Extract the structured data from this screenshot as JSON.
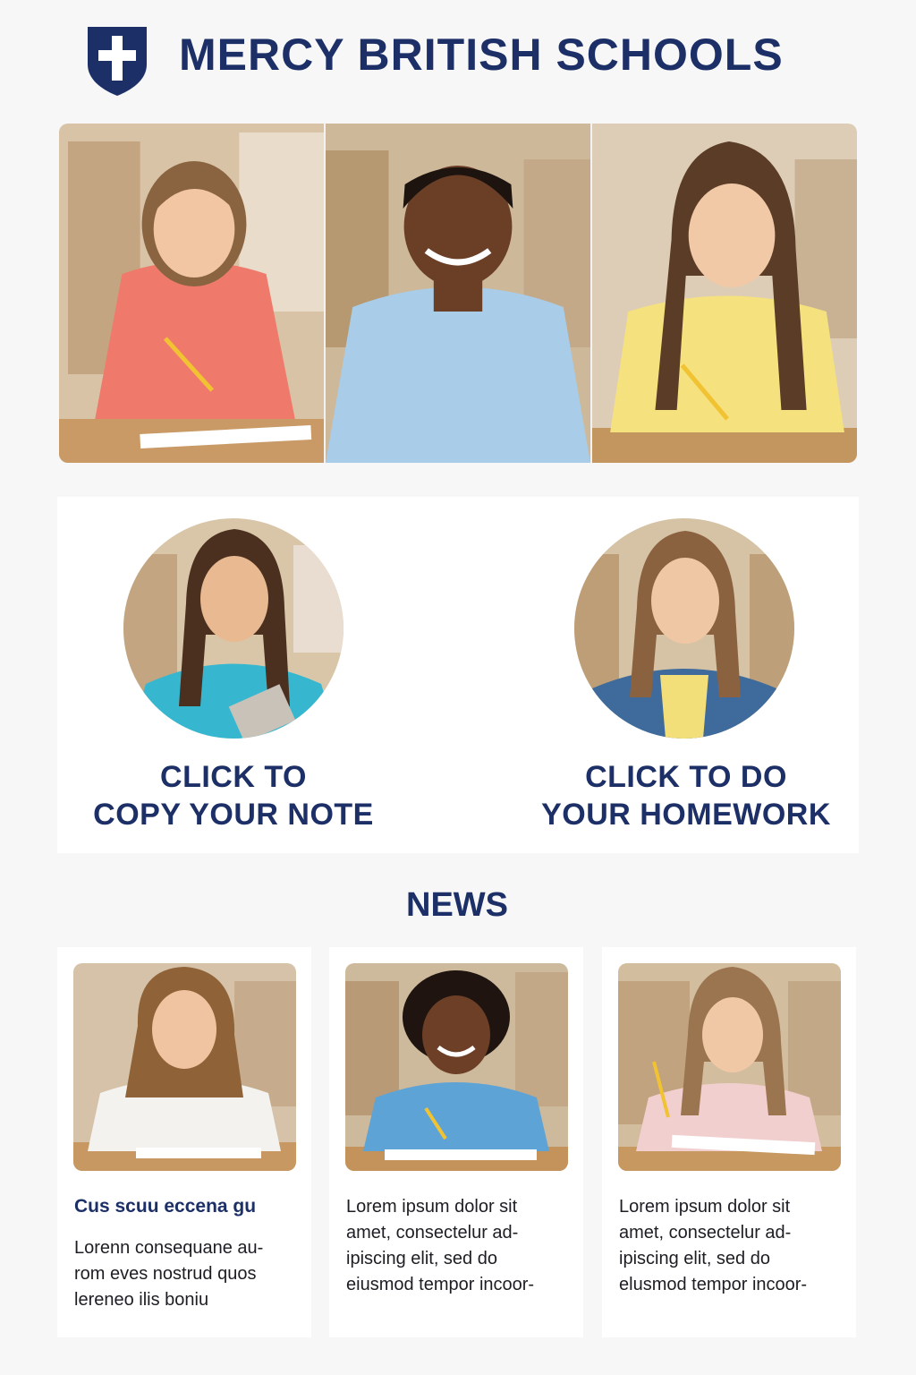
{
  "school": {
    "name": "MERCY BRITISH SCHOOLS",
    "crest_icon": "shield-cross-icon",
    "brand_color": "#1c2f66"
  },
  "actions": [
    {
      "label_lines": [
        "CLICK TO",
        "COPY YOUR NOTE"
      ]
    },
    {
      "label_lines": [
        "CLICK TO DO",
        "YOUR HOMEWORK"
      ]
    }
  ],
  "news": {
    "heading": "NEWS",
    "items": [
      {
        "headline": "Cus scuu eccena gu",
        "body_lines": [
          "Lorenn consequane au-",
          "rom eves nostrud quos",
          "lereneo ilis boniu"
        ]
      },
      {
        "headline": "",
        "body_lines": [
          "Lorem ipsum dolor sit",
          "amet, consectelur ad-",
          "ipiscing elit, sed do",
          "eiusmod tempor incoor-"
        ]
      },
      {
        "headline": "",
        "body_lines": [
          "Lorem ipsum dolor sit",
          "amet, consectelur ad-",
          "ipiscing elit, sed do",
          "elusmod tempor incoor-"
        ]
      }
    ]
  }
}
